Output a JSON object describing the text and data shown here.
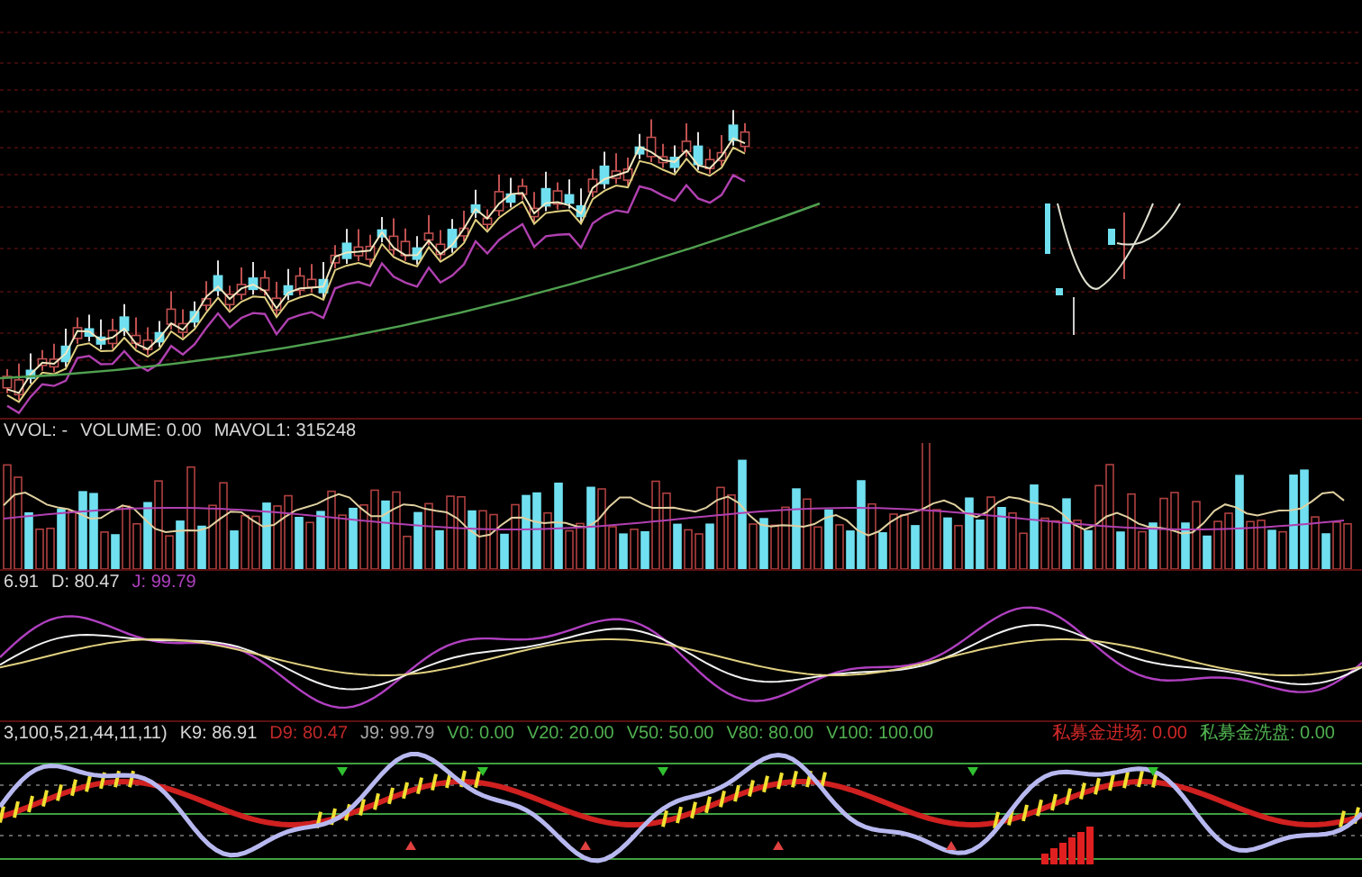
{
  "panels": [
    {
      "kind": "price"
    },
    {
      "kind": "volume",
      "readouts": [
        {
          "text": "VVOL: -",
          "color": "#d8d8d8"
        },
        {
          "text": "VOLUME: 0.00",
          "color": "#d8d8d8"
        },
        {
          "text": "MAVOL1: 315248",
          "color": "#d8d8d8"
        }
      ]
    },
    {
      "kind": "kdj",
      "readouts": [
        {
          "text": "6.91",
          "color": "#d8d8d8"
        },
        {
          "text": "D: 80.47",
          "color": "#d8d8d8"
        },
        {
          "text": "J: 99.79",
          "color": "#b040c0"
        }
      ]
    },
    {
      "kind": "signal",
      "readouts": [
        {
          "text": "3,100,5,21,44,11,11)",
          "color": "#d8d8d8"
        },
        {
          "text": "K9: 86.91",
          "color": "#d8d8d8"
        },
        {
          "text": "D9: 80.47",
          "color": "#c02828"
        },
        {
          "text": "J9: 99.79",
          "color": "#a8a8a8"
        },
        {
          "text": "V0: 0.00",
          "color": "#50b050"
        },
        {
          "text": "V20: 20.00",
          "color": "#50b050"
        },
        {
          "text": "V50: 50.00",
          "color": "#50b050"
        },
        {
          "text": "V80: 80.00",
          "color": "#50b050"
        },
        {
          "text": "V100: 100.00",
          "color": "#50b050"
        }
      ],
      "right_readouts": [
        {
          "text": "私募金进场: 0.00",
          "color": "#d02828"
        },
        {
          "text": "私募金洗盘: 0.00",
          "color": "#50b050"
        }
      ]
    }
  ]
}
